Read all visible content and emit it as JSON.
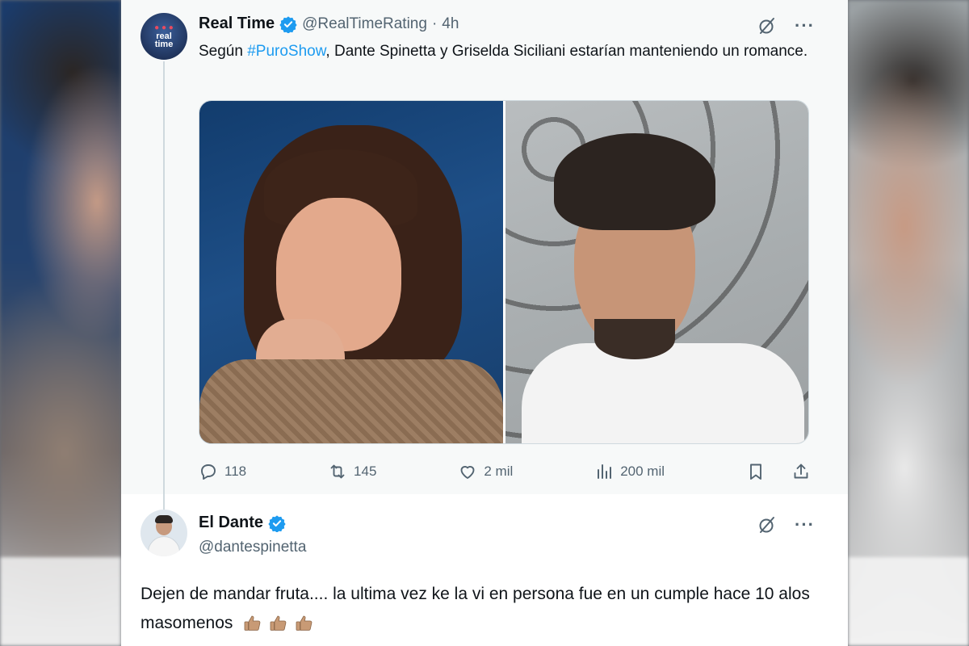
{
  "tweet1": {
    "name": "Real Time",
    "handle": "@RealTimeRating",
    "separator": "·",
    "time": "4h",
    "avatar_text_line1": "real",
    "avatar_text_line2": "time",
    "text_before": "Según ",
    "hashtag": "#PuroShow",
    "text_after": ", Dante Spinetta y Griselda Siciliani estarían manteniendo un romance.",
    "actions": {
      "replies": "118",
      "retweets": "145",
      "likes": "2 mil",
      "views": "200 mil"
    }
  },
  "tweet2": {
    "name": "El Dante",
    "handle": "@dantespinetta",
    "text": "Dejen de mandar fruta.... la ultima vez ke la vi en persona fue en un cumple hace 10 alos masomenos"
  },
  "colors": {
    "accent": "#1d9bf0",
    "text": "#0f1419",
    "secondary": "#536471"
  },
  "icons": [
    "verified-badge-icon",
    "grok-icon",
    "more-icon",
    "reply-icon",
    "retweet-icon",
    "like-icon",
    "views-icon",
    "bookmark-icon",
    "share-icon",
    "thumbs-up-emoji"
  ]
}
